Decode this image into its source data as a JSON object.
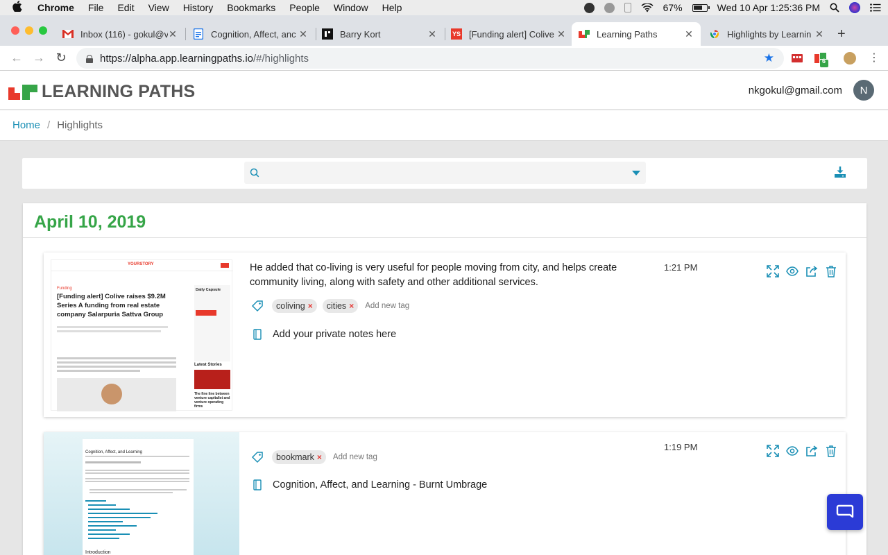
{
  "menubar": {
    "app": "Chrome",
    "items": [
      "File",
      "Edit",
      "View",
      "History",
      "Bookmarks",
      "People",
      "Window",
      "Help"
    ],
    "battery": "67%",
    "clock": "Wed 10 Apr  1:25:36 PM"
  },
  "tabs": [
    {
      "title": "Inbox (116) - gokul@v",
      "favicon": "gmail-icon"
    },
    {
      "title": "Cognition, Affect, anc",
      "favicon": "docs-icon"
    },
    {
      "title": "Barry Kort",
      "favicon": "wiki-icon"
    },
    {
      "title": "[Funding alert] Colive",
      "favicon": "yourstory-icon"
    },
    {
      "title": "Learning Paths",
      "favicon": "learningpaths-icon"
    },
    {
      "title": "Highlights by Learnin",
      "favicon": "chrome-store-icon"
    }
  ],
  "address": {
    "host": "https://alpha.app.learningpaths.io",
    "path": "/#/highlights",
    "ext_badge": "6"
  },
  "app": {
    "brand": "LEARNING PATHS",
    "user_email": "nkgokul@gmail.com",
    "avatar_initial": "N",
    "colors": {
      "green": "#36a548",
      "blue": "#1a8fb5",
      "red": "#e8392b"
    }
  },
  "breadcrumb": {
    "home": "Home",
    "current": "Highlights"
  },
  "search": {
    "placeholder": "",
    "value": ""
  },
  "day": {
    "date": "April 10, 2019"
  },
  "highlights": [
    {
      "text": "He added that co-living is very useful for people moving from city, and helps create community living, along with safety and other additional services.",
      "time": "1:21 PM",
      "tags": [
        "coliving",
        "cities"
      ],
      "add_tag": "Add new tag",
      "note": "Add your private notes here",
      "thumb": {
        "site": "YOURSTORY",
        "category": "Funding",
        "headline": "[Funding alert] Colive raises $9.2M Series A funding from real estate company Salarpuria Sattva Group",
        "sidebar_title": "Daily Capsule",
        "latest": "Latest Stories",
        "latest_story": "The fine line between venture capitalist and venture operating firms"
      }
    },
    {
      "text": "",
      "time": "1:19 PM",
      "tags": [
        "bookmark"
      ],
      "add_tag": "Add new tag",
      "note": "Cognition, Affect, and Learning - Burnt Umbrage",
      "thumb": {
        "headline": "Cognition, Affect, and Learning",
        "section": "Introduction"
      }
    }
  ]
}
